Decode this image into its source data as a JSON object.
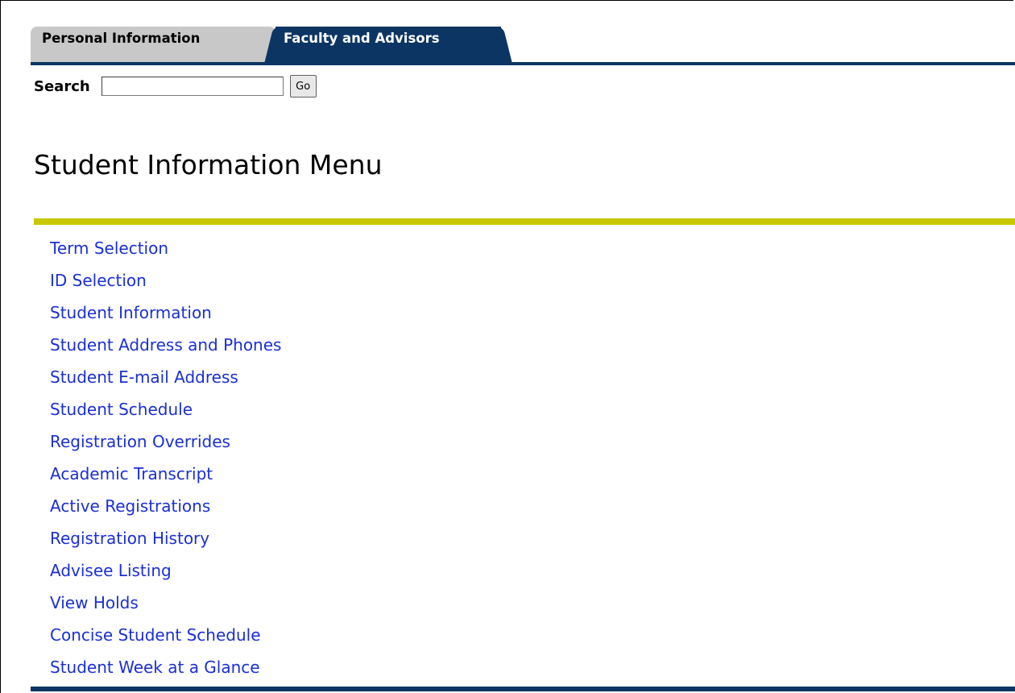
{
  "tabs": [
    {
      "label": "Personal Information",
      "active": false
    },
    {
      "label": "Faculty and Advisors",
      "active": true
    }
  ],
  "search": {
    "label": "Search",
    "value": "",
    "button_label": "Go"
  },
  "page": {
    "title": "Student Information Menu"
  },
  "menu": {
    "items": [
      {
        "label": "Term Selection"
      },
      {
        "label": "ID Selection"
      },
      {
        "label": "Student Information"
      },
      {
        "label": "Student Address and Phones"
      },
      {
        "label": "Student E-mail Address"
      },
      {
        "label": "Student Schedule"
      },
      {
        "label": "Registration Overrides"
      },
      {
        "label": "Academic Transcript"
      },
      {
        "label": "Active Registrations"
      },
      {
        "label": "Registration History"
      },
      {
        "label": "Advisee Listing"
      },
      {
        "label": "View Holds"
      },
      {
        "label": "Concise Student Schedule"
      },
      {
        "label": "Student Week at a Glance"
      }
    ]
  },
  "colors": {
    "tab_active_bg": "#0c3563",
    "tab_inactive_bg": "#c8c8c8",
    "accent_rule": "#c8c800",
    "link": "#1a2fd6"
  }
}
